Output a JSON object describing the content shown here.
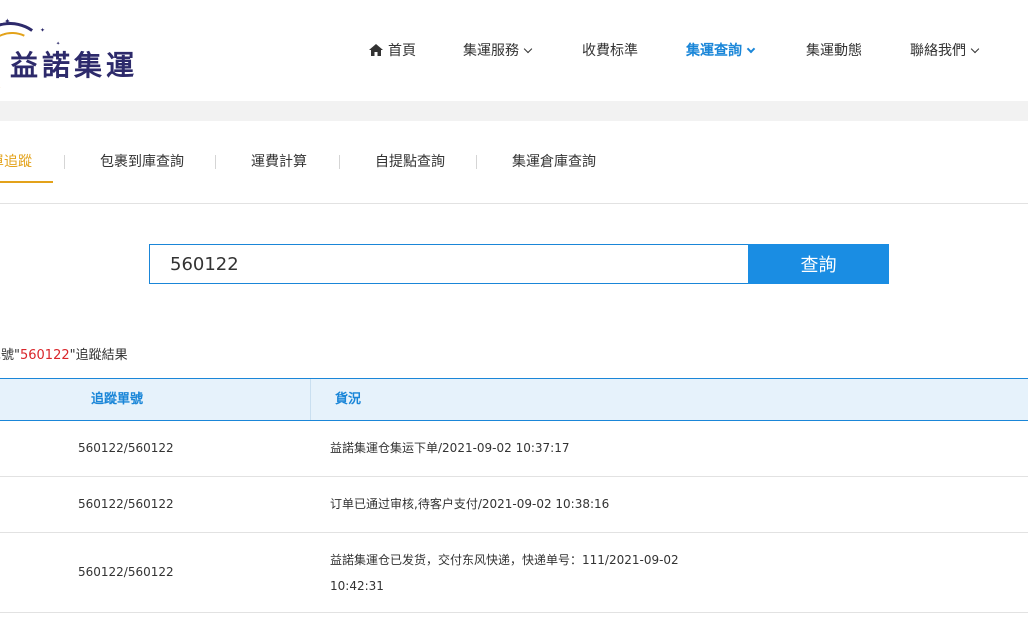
{
  "brand": {
    "logo_text": "益諾集運"
  },
  "nav": {
    "items": [
      {
        "label": "首頁",
        "icon": "home-icon"
      },
      {
        "label": "集運服務",
        "dropdown": true
      },
      {
        "label": "收費标準"
      },
      {
        "label": "集運查詢",
        "dropdown": true,
        "active": true
      },
      {
        "label": "集運動態"
      },
      {
        "label": "聯絡我們",
        "dropdown": true
      }
    ],
    "active_color": "#1a86d8"
  },
  "subtabs": {
    "items": [
      {
        "label": "運單追蹤",
        "active": true
      },
      {
        "label": "包裹到庫查詢"
      },
      {
        "label": "運費計算"
      },
      {
        "label": "自提點查詢"
      },
      {
        "label": "集運倉庫查詢"
      }
    ],
    "active_color": "#e3a21a"
  },
  "search": {
    "value": "560122",
    "button_label": "查詢",
    "button_color": "#1a8de3"
  },
  "result": {
    "prefix": "單號\"",
    "number": "560122",
    "suffix": "\"追蹤結果",
    "number_color": "#d9262b"
  },
  "table": {
    "headers": {
      "tracking_no": "追蹤單號",
      "status": "貨況"
    },
    "rows": [
      {
        "tracking_no": "560122/560122",
        "status": "益諾集運仓集运下单/2021-09-02 10:37:17"
      },
      {
        "tracking_no": "560122/560122",
        "status": "订单已通过审核,待客户支付/2021-09-02 10:38:16"
      },
      {
        "tracking_no": "560122/560122",
        "status": "益諾集運仓已发货，交付东风快递，快递单号：111/2021-09-02 10:42:31"
      }
    ]
  }
}
